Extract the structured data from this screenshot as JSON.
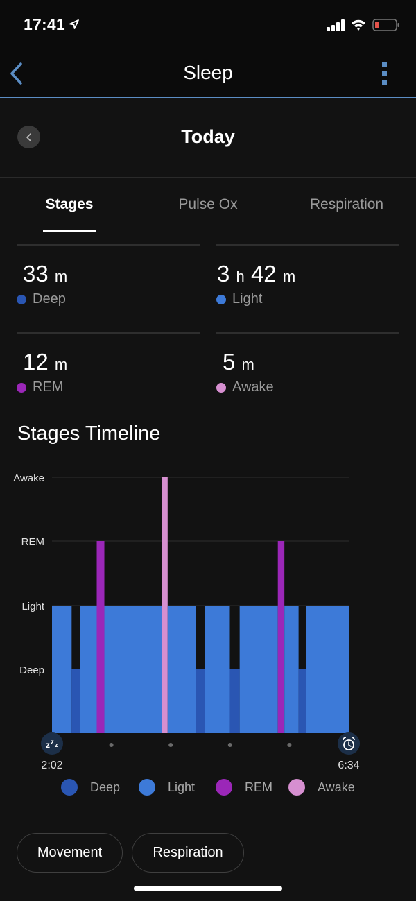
{
  "status_bar": {
    "time": "17:41",
    "location_icon": "location-arrow-icon",
    "signal_icon": "cellular-signal-icon",
    "wifi_icon": "wifi-icon",
    "battery_icon": "battery-low-icon",
    "battery_color": "#e5534b"
  },
  "nav": {
    "title": "Sleep",
    "back_icon": "chevron-left-icon",
    "more_icon": "more-vertical-icon",
    "accent": "#5b8dc4"
  },
  "date_nav": {
    "title": "Today",
    "prev_icon": "chevron-left-icon"
  },
  "tabs": [
    {
      "label": "Stages",
      "active": true
    },
    {
      "label": "Pulse Ox",
      "active": false
    },
    {
      "label": "Respiration",
      "active": false
    }
  ],
  "stats": [
    {
      "id": "deep",
      "parts": [
        {
          "num": "33",
          "unit": "m"
        }
      ],
      "label": "Deep",
      "color": "#2a56b3"
    },
    {
      "id": "light",
      "parts": [
        {
          "num": "3",
          "unit": "h"
        },
        {
          "num": "42",
          "unit": "m"
        }
      ],
      "label": "Light",
      "color": "#3d7ad8"
    },
    {
      "id": "rem",
      "parts": [
        {
          "num": "12",
          "unit": "m"
        }
      ],
      "label": "REM",
      "color": "#9b27b8"
    },
    {
      "id": "awake",
      "parts": [
        {
          "num": "5",
          "unit": "m"
        }
      ],
      "label": "Awake",
      "color": "#d68fd0"
    }
  ],
  "section_title": "Stages Timeline",
  "chart_data": {
    "type": "area",
    "title": "Stages Timeline",
    "y_levels": [
      "Deep",
      "Light",
      "REM",
      "Awake"
    ],
    "y_tick_labels": [
      "Awake",
      "REM",
      "Light",
      "Deep"
    ],
    "x_start_label": "2:02",
    "x_end_label": "6:34",
    "x_start_minutes": 0,
    "x_end_minutes": 272,
    "x_tick_dots": 4,
    "start_icon": "sleep-zzz-icon",
    "end_icon": "alarm-clock-icon",
    "grid": true,
    "colors": {
      "Deep": "#2a56b3",
      "Light": "#3d7ad8",
      "REM": "#9b27b8",
      "Awake": "#d68fd0"
    },
    "segments": [
      {
        "stage": "Light",
        "start": 0,
        "end": 18
      },
      {
        "stage": "Deep",
        "start": 18,
        "end": 26
      },
      {
        "stage": "Light",
        "start": 26,
        "end": 41
      },
      {
        "stage": "REM",
        "start": 41,
        "end": 48
      },
      {
        "stage": "Light",
        "start": 48,
        "end": 101
      },
      {
        "stage": "Awake",
        "start": 101,
        "end": 106
      },
      {
        "stage": "Light",
        "start": 106,
        "end": 132
      },
      {
        "stage": "Deep",
        "start": 132,
        "end": 140
      },
      {
        "stage": "Light",
        "start": 140,
        "end": 163
      },
      {
        "stage": "Deep",
        "start": 163,
        "end": 172
      },
      {
        "stage": "Light",
        "start": 172,
        "end": 207
      },
      {
        "stage": "REM",
        "start": 207,
        "end": 213
      },
      {
        "stage": "Light",
        "start": 213,
        "end": 226
      },
      {
        "stage": "Deep",
        "start": 226,
        "end": 233
      },
      {
        "stage": "Light",
        "start": 233,
        "end": 272
      }
    ]
  },
  "legend": [
    {
      "label": "Deep",
      "color": "#2a56b3"
    },
    {
      "label": "Light",
      "color": "#3d7ad8"
    },
    {
      "label": "REM",
      "color": "#9b27b8"
    },
    {
      "label": "Awake",
      "color": "#d68fd0"
    }
  ],
  "actions": [
    {
      "label": "Movement"
    },
    {
      "label": "Respiration"
    }
  ]
}
